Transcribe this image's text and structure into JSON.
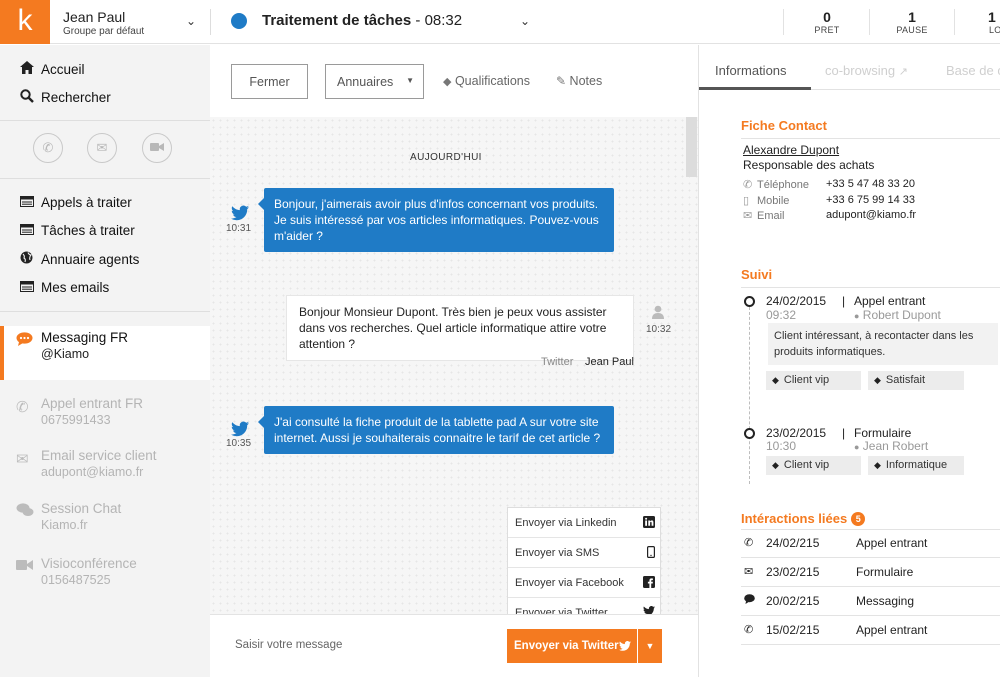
{
  "app": {
    "logo_letter": "k",
    "accent": "#f47a20",
    "blue": "#1f7bc6"
  },
  "user": {
    "name": "Jean Paul",
    "group": "Groupe par défaut"
  },
  "task": {
    "title": "Traitement de tâches",
    "time": "- 08:32",
    "status_color": "#1f7bc6"
  },
  "stats": [
    {
      "value": "0",
      "label": "PRET"
    },
    {
      "value": "1",
      "label": "PAUSE"
    },
    {
      "value": "1",
      "label": "LO"
    }
  ],
  "sidebar": {
    "nav": [
      {
        "label": "Accueil",
        "icon": "home-icon"
      },
      {
        "label": "Rechercher",
        "icon": "search-icon"
      }
    ],
    "quick_actions": [
      "phone-icon",
      "email-icon",
      "video-icon"
    ],
    "lists": [
      {
        "label": "Appels à traiter",
        "icon": "list-icon"
      },
      {
        "label": "Tâches à traiter",
        "icon": "list-icon"
      },
      {
        "label": "Annuaire agents",
        "icon": "globe-icon"
      },
      {
        "label": "Mes emails",
        "icon": "list-icon"
      }
    ],
    "channels": [
      {
        "title": "Messaging FR",
        "sub": "@Kiamo",
        "icon": "chat-icon",
        "active": true
      },
      {
        "title": "Appel entrant FR",
        "sub": "0675991433",
        "icon": "phone-icon",
        "active": false
      },
      {
        "title": "Email service client",
        "sub": "adupont@kiamo.fr",
        "icon": "email-icon",
        "active": false
      },
      {
        "title": "Session Chat",
        "sub": "Kiamo.fr",
        "icon": "chat-bubbles-icon",
        "active": false
      },
      {
        "title": "Visioconférence",
        "sub": "0156487525",
        "icon": "video-icon",
        "active": false
      }
    ]
  },
  "toolbar": {
    "close_label": "Fermer",
    "directory_label": "Annuaires",
    "qualifications_label": "Qualifications",
    "notes_label": "Notes"
  },
  "chat": {
    "day_label": "AUJOURD'HUI",
    "messages": [
      {
        "direction": "in",
        "text": "Bonjour, j'aimerais avoir plus d'infos concernant vos produits. Je suis intéressé par vos articles informatiques. Pouvez-vous m'aider ?",
        "time": "10:31"
      },
      {
        "direction": "out",
        "text": "Bonjour Monsieur Dupont. Très bien je peux vous assister dans vos recherches. Quel article informatique attire votre attention ?",
        "time": "10:32",
        "channel": "Twitter",
        "agent": "Jean Paul"
      },
      {
        "direction": "in",
        "text": "J'ai consulté la fiche produit de la tablette pad A sur votre site internet. Aussi je souhaiterais connaitre le tarif de cet article ?",
        "time": "10:35"
      }
    ]
  },
  "send_options": [
    {
      "label": "Envoyer via Linkedin",
      "icon": "linkedin-icon"
    },
    {
      "label": "Envoyer via SMS",
      "icon": "mobile-icon"
    },
    {
      "label": "Envoyer via Facebook",
      "icon": "facebook-icon"
    },
    {
      "label": "Envoyer via Twitter",
      "icon": "twitter-icon"
    }
  ],
  "composer": {
    "placeholder": "Saisir votre message",
    "send_label": "Envoyer via Twitter"
  },
  "right_tabs": [
    {
      "label": "Informations",
      "active": true
    },
    {
      "label": "co-browsing",
      "active": false
    },
    {
      "label": "Base de c",
      "active": false
    }
  ],
  "contact": {
    "section_title": "Fiche Contact",
    "name": "Alexandre Dupont",
    "role": "Responsable des achats",
    "fields": [
      {
        "label": "Téléphone",
        "value": "+33 5 47 48 33 20",
        "icon": "phone-icon"
      },
      {
        "label": "Mobile",
        "value": "+33 6 75 99 14 33",
        "icon": "mobile-icon"
      },
      {
        "label": "Email",
        "value": "adupont@kiamo.fr",
        "icon": "email-icon"
      }
    ]
  },
  "suivi": {
    "section_title": "Suivi",
    "entries": [
      {
        "date": "24/02/2015",
        "time": "09:32",
        "type": "Appel entrant",
        "agent": "Robert Dupont",
        "note": "Client intéressant, à recontacter dans les produits informatiques.",
        "tags": [
          "Client vip",
          "Satisfait"
        ]
      },
      {
        "date": "23/02/2015",
        "time": "10:30",
        "type": "Formulaire",
        "agent": "Jean Robert",
        "note": "",
        "tags": [
          "Client vip",
          "Informatique"
        ]
      }
    ]
  },
  "interactions": {
    "section_title": "Intéractions liées",
    "count": "5",
    "rows": [
      {
        "date": "24/02/215",
        "type": "Appel entrant",
        "icon": "phone-icon"
      },
      {
        "date": "23/02/215",
        "type": "Formulaire",
        "icon": "email-icon"
      },
      {
        "date": "20/02/215",
        "type": "Messaging",
        "icon": "chat-icon"
      },
      {
        "date": "15/02/215",
        "type": "Appel entrant",
        "icon": "phone-icon"
      }
    ]
  }
}
